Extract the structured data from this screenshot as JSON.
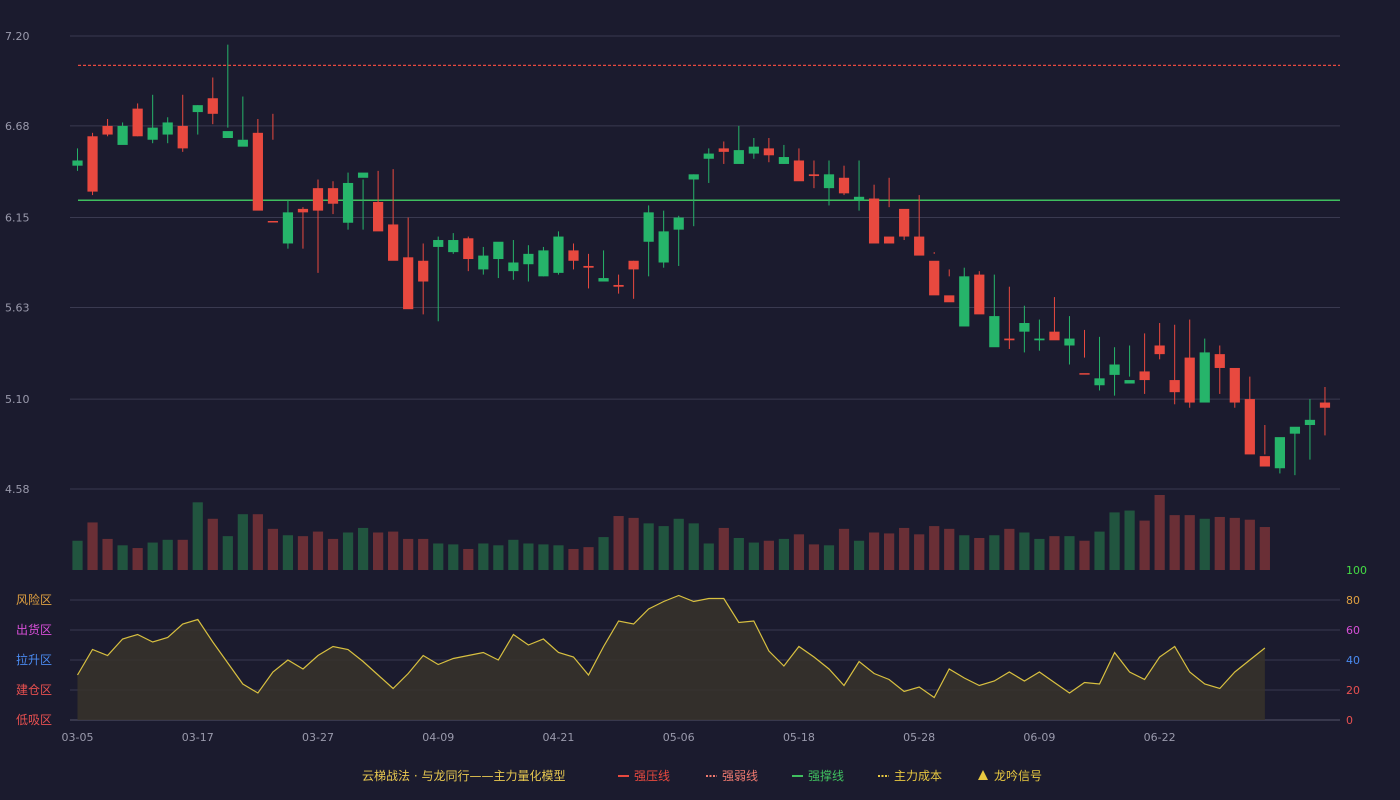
{
  "colors": {
    "background": "#1b1b2e",
    "up": "#e8493f",
    "down": "#26b46a",
    "vol_up": "#6a2f36",
    "vol_down": "#21553f",
    "grid": "#3a3a50",
    "strong_pressure": "#e8493f",
    "weak_pressure": "#f07a70",
    "support": "#3fbf5f",
    "osc_line": "#d8c040",
    "osc_fill": "#37322a",
    "axis_text": "#9a9aac"
  },
  "chart_data": {
    "type": "candlestick",
    "dates": [
      "03-05",
      "03-06",
      "03-07",
      "03-10",
      "03-11",
      "03-12",
      "03-13",
      "03-14",
      "03-17",
      "03-18",
      "03-19",
      "03-20",
      "03-21",
      "03-24",
      "03-25",
      "03-26",
      "03-27",
      "03-28",
      "03-31",
      "04-01",
      "04-02",
      "04-03",
      "04-07",
      "04-08",
      "04-09",
      "04-10",
      "04-11",
      "04-14",
      "04-15",
      "04-16",
      "04-17",
      "04-18",
      "04-21",
      "04-22",
      "04-23",
      "04-24",
      "04-25",
      "04-28",
      "04-29",
      "04-30",
      "05-06",
      "05-07",
      "05-08",
      "05-09",
      "05-12",
      "05-13",
      "05-14",
      "05-15",
      "05-16",
      "05-19",
      "05-20",
      "05-21",
      "05-22",
      "05-23",
      "05-26",
      "05-27",
      "05-28",
      "05-29",
      "05-30",
      "06-03",
      "06-04",
      "06-05",
      "06-06",
      "06-09",
      "06-10",
      "06-11",
      "06-12",
      "06-13",
      "06-16",
      "06-17",
      "06-18",
      "06-19",
      "06-20",
      "06-23",
      "06-24",
      "06-25",
      "06-26",
      "06-27",
      "06-30",
      "07-01",
      "07-02",
      "07-03",
      "07-04",
      "07-07"
    ],
    "x_ticks": [
      "03-05",
      "03-17",
      "03-27",
      "04-09",
      "04-21",
      "05-06",
      "05-18",
      "05-28",
      "06-09",
      "06-22"
    ],
    "x_tick_index": [
      0,
      8,
      16,
      24,
      32,
      40,
      48,
      56,
      64,
      72
    ],
    "price_axis": {
      "ticks": [
        "7.20",
        "6.68",
        "6.15",
        "5.63",
        "5.10",
        "4.58"
      ],
      "min": 4.58,
      "max": 7.2
    },
    "open": [
      6.48,
      6.3,
      6.63,
      6.68,
      6.62,
      6.67,
      6.7,
      6.55,
      6.8,
      6.75,
      6.65,
      6.6,
      6.19,
      6.13,
      6.18,
      6.18,
      6.19,
      6.23,
      6.35,
      6.41,
      6.07,
      5.9,
      5.62,
      5.78,
      6.02,
      6.02,
      5.91,
      5.93,
      6.01,
      5.89,
      5.94,
      5.96,
      6.04,
      5.9,
      5.86,
      5.8,
      5.75,
      5.85,
      6.18,
      6.07,
      6.15,
      6.4,
      6.52,
      6.53,
      6.54,
      6.56,
      6.51,
      6.5,
      6.36,
      6.39,
      6.4,
      6.29,
      6.27,
      6.0,
      6.0,
      6.04,
      5.93,
      5.7,
      5.66,
      5.81,
      5.59,
      5.58,
      5.44,
      5.54,
      5.45,
      5.44,
      5.45,
      5.25,
      5.22,
      5.3,
      5.21,
      5.21,
      5.36,
      5.14,
      5.08,
      5.37,
      5.28,
      5.08,
      4.78,
      4.71,
      4.88,
      4.94,
      4.98,
      5.05
    ],
    "close": [
      6.45,
      6.62,
      6.68,
      6.57,
      6.78,
      6.6,
      6.63,
      6.68,
      6.76,
      6.84,
      6.61,
      6.56,
      6.64,
      6.13,
      6.0,
      6.2,
      6.32,
      6.32,
      6.12,
      6.38,
      6.24,
      6.11,
      5.92,
      5.9,
      5.98,
      5.95,
      6.03,
      5.85,
      5.91,
      5.84,
      5.88,
      5.81,
      5.83,
      5.96,
      5.87,
      5.78,
      5.76,
      5.9,
      6.01,
      5.89,
      6.08,
      6.37,
      6.49,
      6.55,
      6.46,
      6.52,
      6.55,
      6.46,
      6.48,
      6.4,
      6.32,
      6.38,
      6.25,
      6.26,
      6.04,
      6.2,
      6.04,
      5.9,
      5.7,
      5.52,
      5.82,
      5.4,
      5.45,
      5.49,
      5.44,
      5.49,
      5.41,
      5.25,
      5.18,
      5.24,
      5.19,
      5.26,
      5.41,
      5.21,
      5.34,
      5.08,
      5.36,
      5.28,
      5.1,
      4.77,
      4.7,
      4.9,
      4.95,
      5.08
    ],
    "high": [
      6.55,
      6.64,
      6.72,
      6.7,
      6.81,
      6.86,
      6.73,
      6.86,
      6.8,
      6.96,
      7.15,
      6.85,
      6.72,
      6.75,
      6.25,
      6.21,
      6.37,
      6.36,
      6.41,
      6.37,
      6.42,
      6.43,
      6.15,
      6.0,
      6.04,
      6.06,
      6.04,
      5.98,
      5.95,
      6.02,
      5.99,
      5.98,
      6.07,
      6.0,
      5.94,
      5.96,
      5.82,
      5.9,
      6.22,
      6.19,
      6.16,
      6.4,
      6.55,
      6.59,
      6.68,
      6.61,
      6.61,
      6.57,
      6.55,
      6.48,
      6.48,
      6.45,
      6.48,
      6.34,
      6.38,
      6.18,
      6.28,
      5.94,
      5.81,
      5.86,
      5.84,
      5.82,
      5.75,
      5.64,
      5.56,
      5.69,
      5.58,
      5.5,
      5.46,
      5.4,
      5.41,
      5.48,
      5.54,
      5.53,
      5.56,
      5.45,
      5.41,
      5.26,
      5.23,
      4.95,
      4.81,
      4.92,
      5.1,
      5.17
    ],
    "low": [
      6.42,
      6.28,
      6.62,
      6.58,
      6.62,
      6.58,
      6.58,
      6.53,
      6.63,
      6.69,
      6.67,
      6.6,
      6.55,
      6.6,
      5.97,
      5.97,
      5.83,
      6.17,
      6.08,
      6.08,
      6.19,
      6.09,
      5.88,
      5.59,
      5.55,
      5.94,
      5.84,
      5.82,
      5.8,
      5.79,
      5.78,
      5.81,
      5.82,
      5.85,
      5.74,
      5.8,
      5.71,
      5.68,
      5.81,
      5.86,
      5.87,
      6.1,
      6.35,
      6.46,
      6.48,
      6.49,
      6.47,
      6.46,
      6.44,
      6.32,
      6.22,
      6.28,
      6.19,
      6.23,
      6.21,
      6.02,
      5.95,
      5.95,
      5.85,
      5.65,
      5.63,
      5.55,
      5.39,
      5.37,
      5.38,
      5.45,
      5.3,
      5.34,
      5.15,
      5.12,
      5.23,
      5.13,
      5.33,
      5.07,
      5.05,
      5.1,
      5.13,
      5.05,
      4.91,
      4.78,
      4.67,
      4.66,
      4.75,
      4.89,
      4.96
    ],
    "volume": [
      32,
      52,
      34,
      27,
      24,
      30,
      33,
      33,
      74,
      56,
      37,
      61,
      61,
      45,
      38,
      37,
      42,
      34,
      41,
      46,
      41,
      42,
      34,
      34,
      29,
      28,
      23,
      29,
      27,
      33,
      29,
      28,
      27,
      23,
      25,
      36,
      59,
      57,
      51,
      48,
      56,
      51,
      29,
      46,
      35,
      30,
      32,
      34,
      39,
      28,
      27,
      45,
      32,
      41,
      40,
      46,
      39,
      48,
      45,
      38,
      35,
      38,
      45,
      41,
      34,
      37,
      37,
      32,
      42,
      63,
      65,
      54,
      82,
      60,
      60,
      56,
      58,
      57,
      55,
      47
    ],
    "strong_pressure_line": 7.03,
    "support_line": 6.25,
    "oscillator": {
      "left_zones": [
        "风险区",
        "出货区",
        "拉升区",
        "建仓区",
        "低吸区"
      ],
      "right_ticks": [
        "100",
        "80",
        "60",
        "40",
        "20",
        "0"
      ],
      "range": [
        0,
        100
      ],
      "values": [
        30,
        47,
        43,
        54,
        57,
        52,
        55,
        64,
        67,
        52,
        38,
        24,
        18,
        32,
        40,
        34,
        43,
        49,
        47,
        39,
        30,
        21,
        31,
        43,
        37,
        41,
        43,
        45,
        40,
        57,
        50,
        54,
        45,
        42,
        30,
        49,
        66,
        64,
        74,
        79,
        83,
        79,
        81,
        81,
        65,
        66,
        46,
        36,
        49,
        42,
        34,
        23,
        39,
        31,
        27,
        19,
        22,
        15,
        34,
        28,
        23,
        26,
        32,
        26,
        32,
        25,
        18,
        25,
        24,
        45,
        32,
        27,
        42,
        49,
        32,
        24,
        21,
        32,
        40,
        48
      ]
    }
  },
  "legend": {
    "title": "云梯战法 · 与龙同行——主力量化模型",
    "items": [
      {
        "label": "强压线",
        "symbol": "solid",
        "color": "#e8493f"
      },
      {
        "label": "强弱线",
        "symbol": "dashed",
        "color": "#f07a70"
      },
      {
        "label": "强撑线",
        "symbol": "solid",
        "color": "#3fbf5f"
      },
      {
        "label": "主力成本",
        "symbol": "dashed",
        "color": "#e8c840"
      },
      {
        "label": "龙吟信号",
        "symbol": "triangle",
        "color": "#e8c840"
      }
    ]
  }
}
